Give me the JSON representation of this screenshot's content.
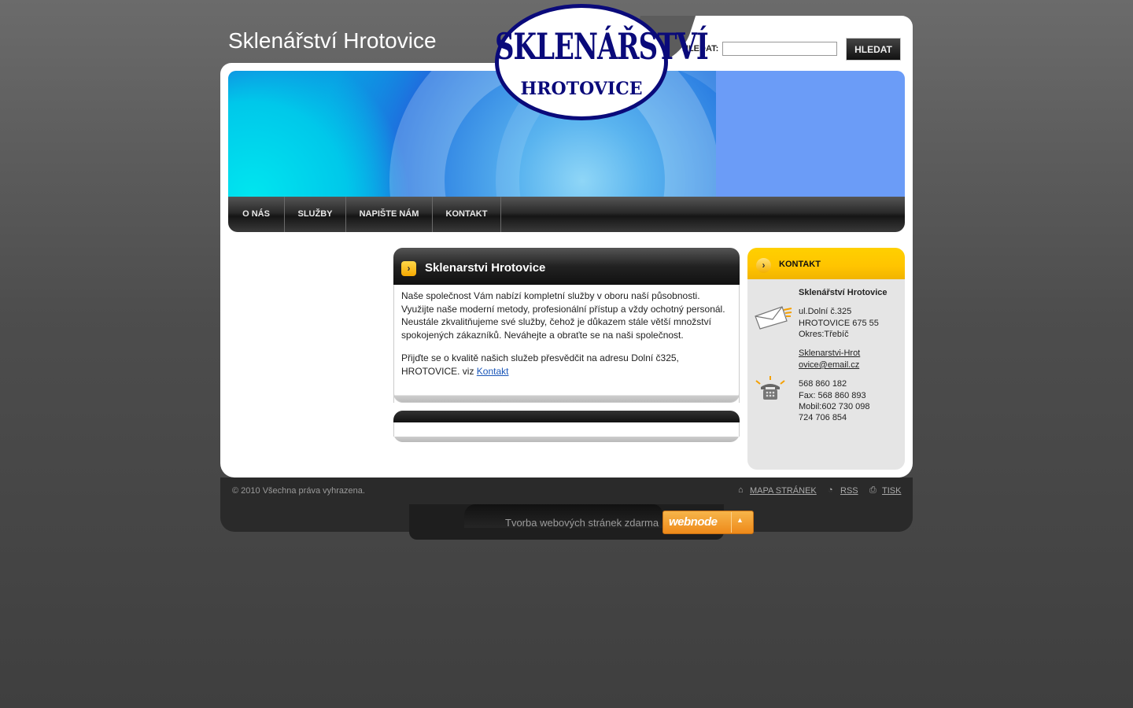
{
  "header": {
    "site_title": "Sklenářství Hrotovice",
    "search_label": "HLEDAT:",
    "search_value": "",
    "search_button": "HLEDAT"
  },
  "banner": {
    "logo_line1": "SKLENÁŘSTVÍ",
    "logo_line2": "HROTOVICE"
  },
  "nav": {
    "items": [
      {
        "label": "O NÁS"
      },
      {
        "label": "SLUŽBY"
      },
      {
        "label": "NAPIŠTE NÁM"
      },
      {
        "label": "KONTAKT"
      }
    ]
  },
  "content": {
    "title": "Sklenarstvi Hrotovice",
    "paragraph1": "Naše společnost Vám nabízí kompletní služby v oboru naší působnosti. Využijte naše moderní metody, profesionální přístup a vždy ochotný personál. Neustále zkvalitňujeme své služby, čehož je důkazem stále větší množství spokojených zákazníků. Neváhejte a obraťte se na naši společnost.",
    "paragraph2_text": "Přijďte se o kvalitě našich služeb přesvědčit na adresu Dolní č325, HROTOVICE. viz ",
    "paragraph2_link": "Kontakt"
  },
  "sidebar": {
    "title": "KONTAKT",
    "company": "Sklenářství Hrotovice",
    "address_line1": "ul.Dolní č.325",
    "address_line2": "HROTOVICE 675 55",
    "address_line3": "Okres:Třebíč",
    "email_part1": "Sklenarstvi-Hrot",
    "email_part2": "ovice@email.cz",
    "phone1": "568 860 182",
    "fax": "Fax: 568 860 893",
    "mobile": "Mobil:602 730 098",
    "phone2": "724 706 854"
  },
  "footer": {
    "copyright": "© 2010 Všechna práva vyhrazena.",
    "sitemap": "MAPA STRÁNEK",
    "rss": "RSS",
    "print": "TISK",
    "powered_text": "Tvorba webových stránek zdarma",
    "webnode_label": "webnode"
  },
  "colors": {
    "accent_yellow": "#ffc400",
    "link_blue": "#1a56b8",
    "logo_navy": "#0a0a7a"
  }
}
